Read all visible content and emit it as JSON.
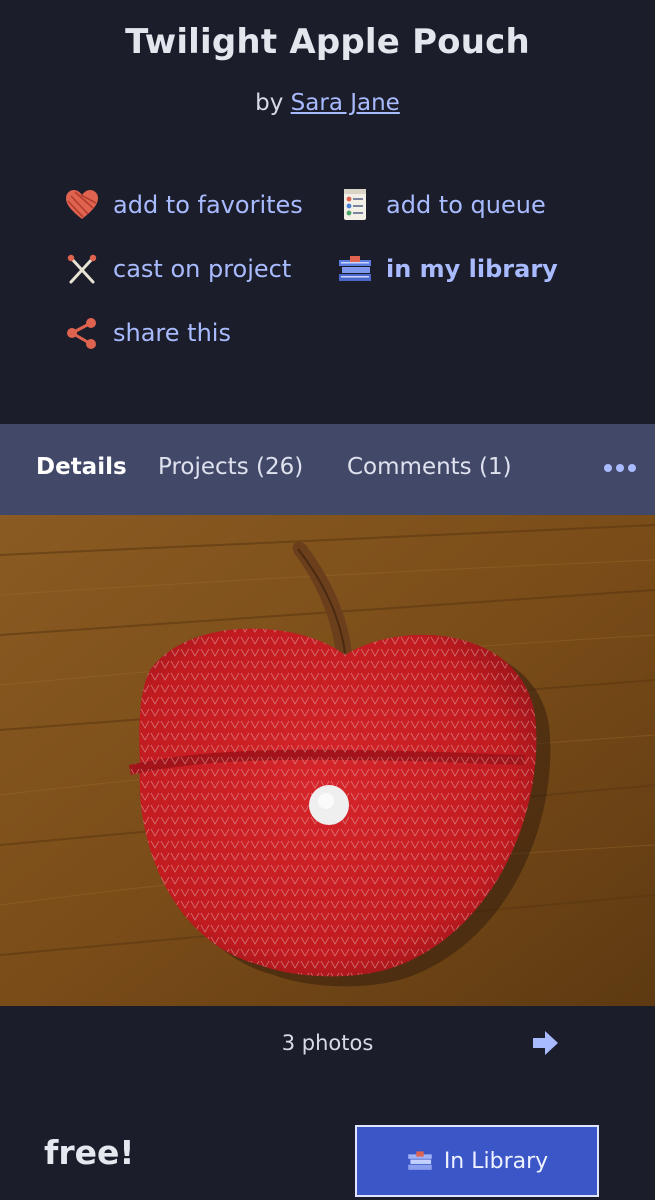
{
  "pattern": {
    "title": "Twilight Apple Pouch",
    "by_prefix": "by",
    "author": "Sara Jane"
  },
  "actions": [
    {
      "label": "add to favorites",
      "icon": "yarn-heart-icon"
    },
    {
      "label": "add to queue",
      "icon": "queue-list-icon"
    },
    {
      "label": "cast on project",
      "icon": "knitting-needles-icon"
    },
    {
      "label": "in my library",
      "icon": "library-books-icon"
    },
    {
      "label": "share this",
      "icon": "share-icon"
    }
  ],
  "tabs": [
    {
      "label": "Details",
      "active": true
    },
    {
      "label": "Projects (26)",
      "active": false
    },
    {
      "label": "Comments (1)",
      "active": false
    }
  ],
  "more_icon": "ellipsis-icon",
  "photos": {
    "count_label": "3 photos",
    "next_icon": "arrow-right-icon"
  },
  "price": "free!",
  "library_button": {
    "label": "In Library",
    "icon": "library-books-icon"
  },
  "colors": {
    "background": "#1b1d2a",
    "accent": "#a9bbff",
    "tabbar": "#424968",
    "button": "#3b57c7"
  }
}
